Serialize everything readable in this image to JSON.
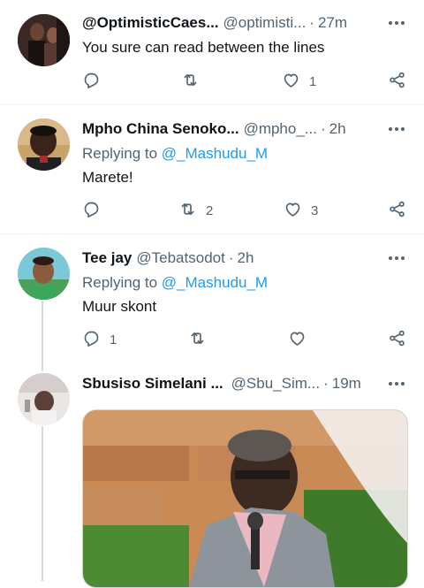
{
  "tweets": [
    {
      "name": "@OptimisticCaes...",
      "handle": "@optimisti...",
      "time": "27m",
      "text": "You sure can read between the lines",
      "likes": "1"
    },
    {
      "name": "Mpho China Senoko...",
      "handle": "@mpho_...",
      "time": "2h",
      "replying_prefix": "Replying to",
      "replying_to": "@_Mashudu_M",
      "text": "Marete!",
      "retweets": "2",
      "likes": "3"
    },
    {
      "name": "Tee jay",
      "handle": "@Tebatsodot",
      "time": "2h",
      "replying_prefix": "Replying to",
      "replying_to": "@_Mashudu_M",
      "text": "Muur skont",
      "replies": "1"
    },
    {
      "name": "Sbusiso Simelani ...",
      "handle": "@Sbu_Sim...",
      "time": "19m"
    }
  ],
  "separator": "·",
  "colors": {
    "accent": "#1d9bf0",
    "muted": "#536471",
    "text": "#0f1419"
  },
  "icons": [
    "reply-icon",
    "retweet-icon",
    "like-icon",
    "share-icon",
    "more-icon"
  ]
}
